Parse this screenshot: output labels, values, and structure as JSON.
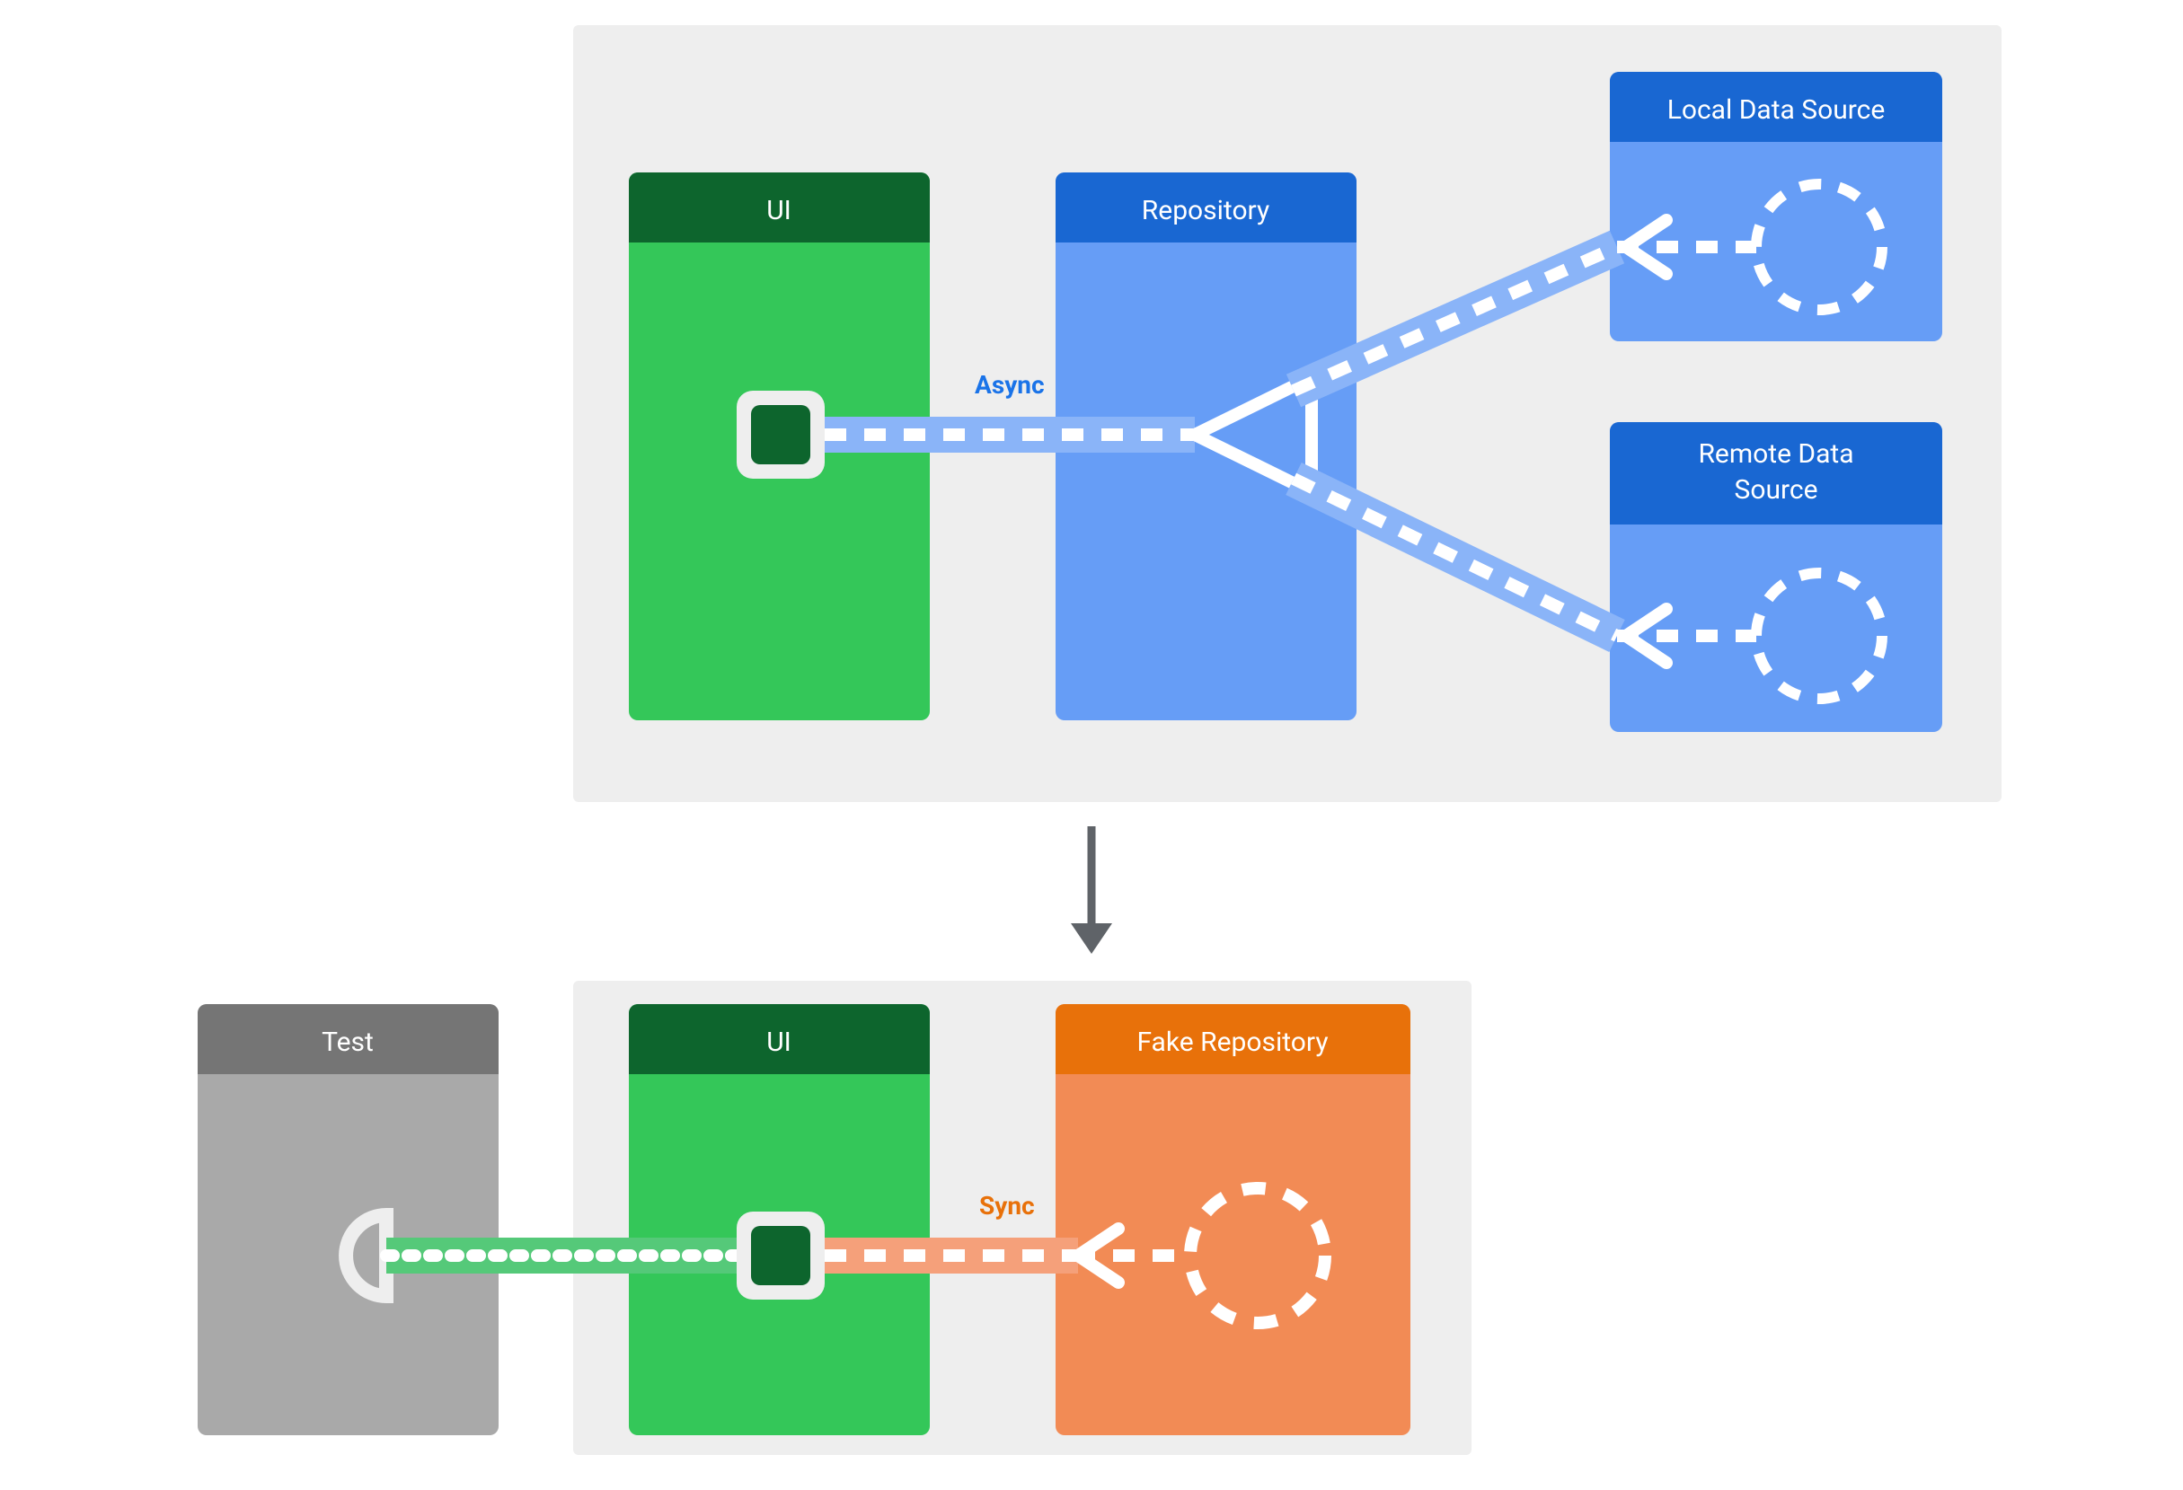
{
  "top": {
    "ui": "UI",
    "repository": "Repository",
    "local": "Local Data Source",
    "remote": "Remote Data Source",
    "async_label": "Async"
  },
  "bottom": {
    "test": "Test",
    "ui": "UI",
    "fake_repo": "Fake Repository",
    "sync_label": "Sync"
  },
  "colors": {
    "bg_panel": "#eeeeee",
    "ui_head": "#0d652d",
    "ui_body": "#34c759",
    "repo_head": "#1967d2",
    "repo_body": "#669df6",
    "test_head": "#757575",
    "test_body": "#a9a9a9",
    "fake_head": "#e8710a",
    "fake_body": "#f28b55",
    "arrow_grey": "#5f6368",
    "white": "#ffffff",
    "green_conn": "#55c979",
    "blue_conn": "#8ab4f8",
    "orange_conn": "#f5a07a"
  }
}
